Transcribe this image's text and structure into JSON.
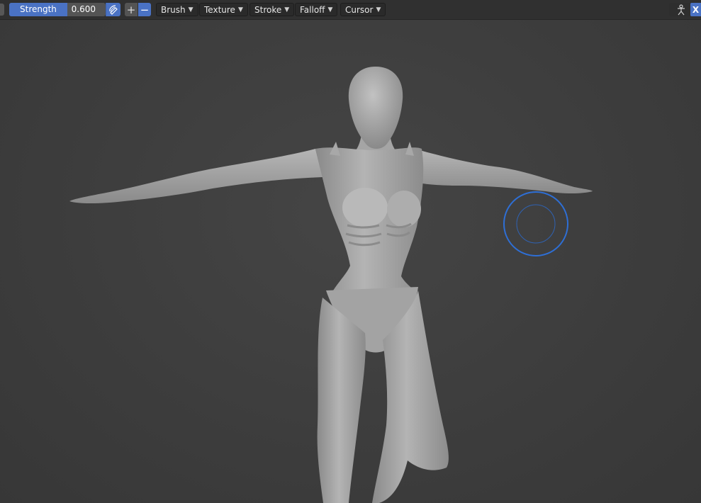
{
  "toolbar": {
    "strength_label": "Strength",
    "strength_value": "0.600",
    "strength_fraction": 0.6,
    "menus": [
      "Brush",
      "Texture",
      "Stroke",
      "Falloff",
      "Cursor"
    ],
    "plus_label": "+",
    "minus_label": "−",
    "close_label": "X"
  },
  "colors": {
    "accent": "#4a72c4",
    "toolbar_bg": "#303030",
    "viewport_bg": "#3d3d3d",
    "model": "#9e9e9e",
    "brush_cursor": "#2e6fd6"
  },
  "icons": {
    "pressure": "pen-pressure-icon",
    "right": "armature-rig-icon"
  }
}
